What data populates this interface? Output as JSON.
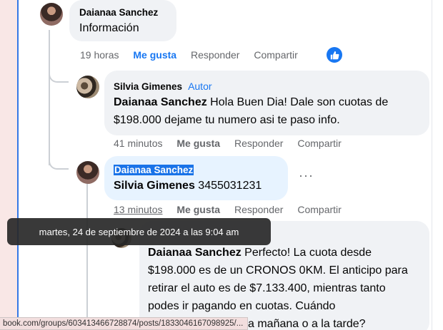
{
  "comment_top": {
    "author": "Daianaa Sanchez",
    "text": "Información",
    "time": "19 horas",
    "like": "Me gusta",
    "reply": "Responder",
    "share": "Compartir"
  },
  "reply1": {
    "author": "Silvia Gimenes",
    "badge": "Autor",
    "mention": "Daianaa Sanchez",
    "text": " Hola Buen Dia! Dale son cuotas de $198.000 dejame tu numero asi te paso info.",
    "time": "41 minutos",
    "like": "Me gusta",
    "reply": "Responder",
    "share": "Compartir"
  },
  "reply2": {
    "author": "Daianaa Sanchez",
    "mention": "Silvia Gimenes",
    "text": " 3455031231",
    "time": "13 minutos",
    "like": "Me gusta",
    "reply": "Responder",
    "share": "Compartir",
    "more": "···"
  },
  "reply3": {
    "mention": "Daianaa Sanchez",
    "text": " Perfecto! La cuota desde $198.000 es de un CRONOS 0KM. El anticipo para retirar el auto es de $7.133.400, mientras tanto podes ir pagando en cuotas. Cuándo",
    "text_tail": "a mañana o a la tarde?"
  },
  "tooltip": "martes, 24 de septiembre de 2024 a las 9:04 am",
  "status_url": "book.com/groups/603413466728874/posts/1833046167098925/...",
  "colors": {
    "accent": "#1877f2",
    "bubble": "#f0f2f5",
    "highlight_bubble": "#e7f3ff"
  },
  "icons": [
    "like-thumb-icon",
    "more-options-icon"
  ]
}
